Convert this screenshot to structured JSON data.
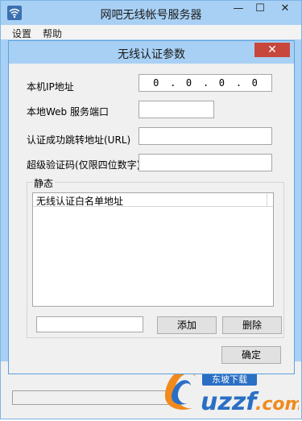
{
  "window": {
    "title": "网吧无线帐号服务器",
    "min_icon": "—",
    "max_icon": "☐",
    "close_icon": "✕"
  },
  "menu": {
    "items": [
      {
        "label": "设置"
      },
      {
        "label": "帮助"
      }
    ]
  },
  "dialog": {
    "title": "无线认证参数",
    "close_icon": "✕",
    "fields": {
      "ip_label": "本机IP地址",
      "ip_octets": [
        "0",
        "0",
        "0",
        "0"
      ],
      "ip_dot": ".",
      "port_label": "本地Web 服务端口",
      "port_value": "",
      "redirect_label": "认证成功跳转地址(URL)",
      "redirect_value": "",
      "supercode_label": "超级验证码(仅限四位数字)",
      "supercode_value": ""
    },
    "group": {
      "label": "静态",
      "list_header": "无线认证白名单地址",
      "add_input": "",
      "add_button": "添加",
      "delete_button": "删除"
    },
    "ok_button": "确定"
  },
  "colors": {
    "titlebar": "#a8d0f4",
    "close_red": "#c8473c",
    "logo_orange": "#f08a1c",
    "logo_blue": "#2a6fc4"
  }
}
